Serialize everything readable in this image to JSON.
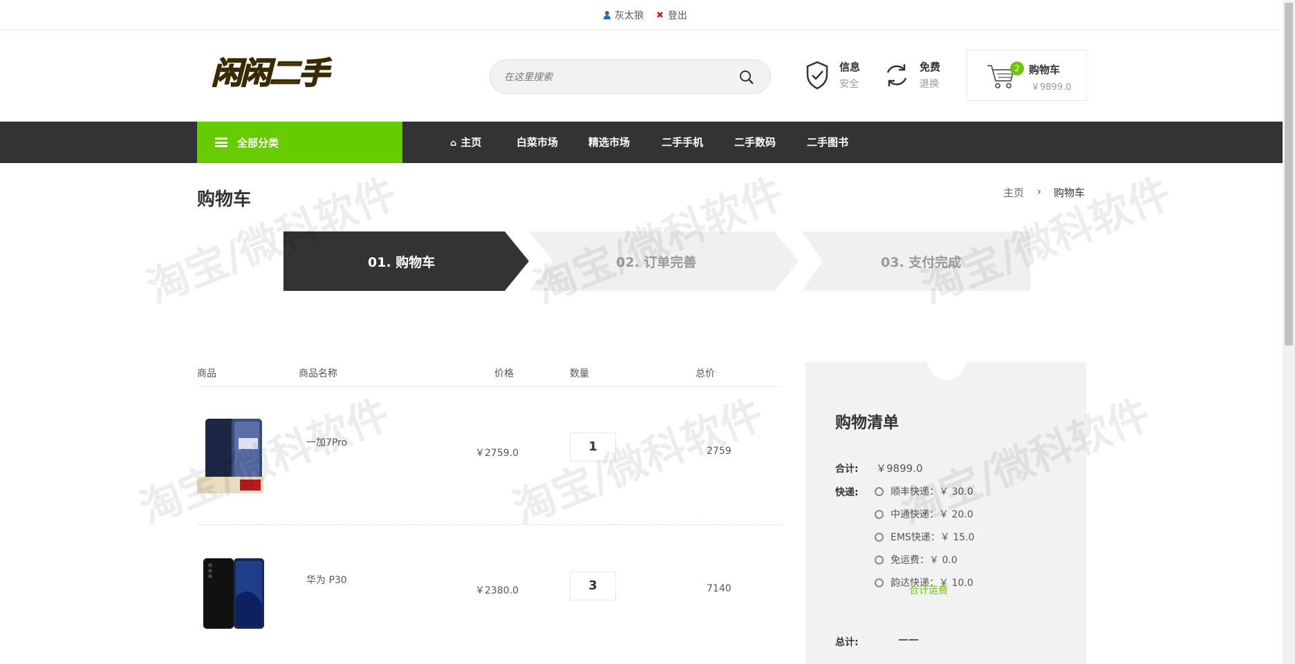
{
  "topbar": {
    "username": "灰太狼",
    "logout": "登出"
  },
  "header": {
    "logo_text": "闲闲二手",
    "search_placeholder": "在这里搜索",
    "feature1": {
      "title": "信息",
      "sub": "安全"
    },
    "feature2": {
      "title": "免费",
      "sub": "退换"
    },
    "cart": {
      "count": "2",
      "label": "购物车",
      "total": "￥9899.0"
    }
  },
  "nav": {
    "all_categories": "全部分类",
    "items": [
      "主页",
      "白菜市场",
      "精选市场",
      "二手手机",
      "二手数码",
      "二手图书"
    ]
  },
  "page": {
    "title": "购物车",
    "breadcrumb_home": "主页",
    "breadcrumb_current": "购物车"
  },
  "steps": [
    "01. 购物车",
    "02. 订单完善",
    "03. 支付完成"
  ],
  "table": {
    "headers": [
      "商品",
      "商品名称",
      "价格",
      "数量",
      "总价"
    ],
    "rows": [
      {
        "name": "一加7Pro",
        "price": "￥2759.0",
        "qty": "1",
        "total": "2759"
      },
      {
        "name": "华为 P30",
        "price": "￥2380.0",
        "qty": "3",
        "total": "7140"
      }
    ]
  },
  "summary": {
    "title": "购物清单",
    "sum_label": "合计:",
    "sum_value": "￥9899.0",
    "ship_label": "快递:",
    "ship_options": [
      "顺丰快递：￥ 30.0",
      "中通快递：￥ 20.0",
      "EMS快递：￥ 15.0",
      "免运费：￥ 0.0",
      "韵达快递：￥ 10.0"
    ],
    "ship_total_label": "合计运费",
    "grand_label": "总计:",
    "grand_value": "——"
  },
  "watermark": "淘宝/微科软件",
  "colors": {
    "accent": "#66cc00",
    "nav_bg": "#333333",
    "summary_bg": "#f2f2f2"
  }
}
